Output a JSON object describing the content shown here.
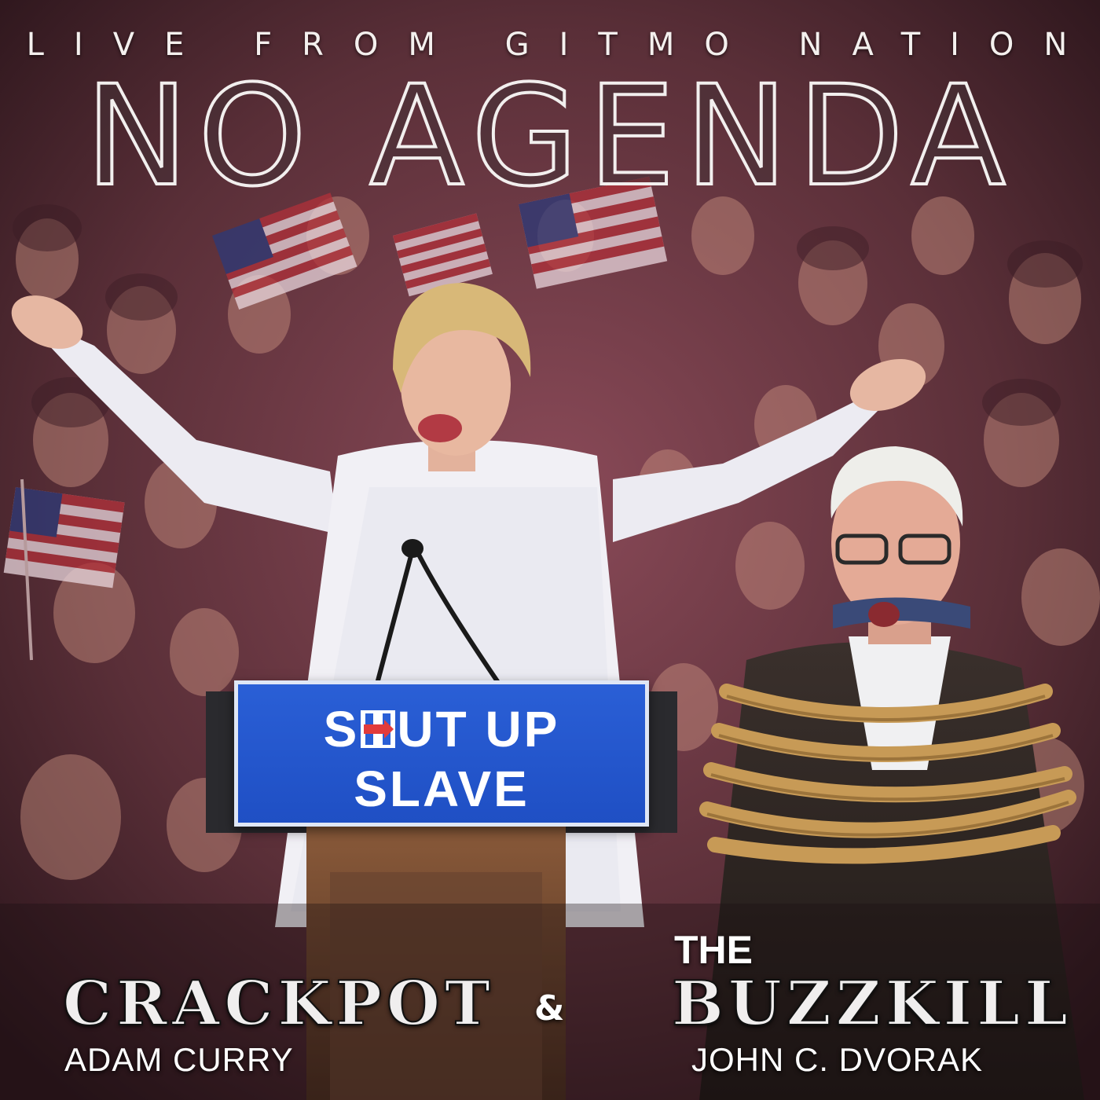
{
  "header": {
    "tagline": "LIVE FROM GITMO NATION",
    "title": "NO AGENDA"
  },
  "podium_sign": {
    "line1_part1": "S",
    "line1_part2": "UT  UP",
    "line2": "SLAVE"
  },
  "credits": {
    "left_role": "CRACKPOT",
    "left_name": "ADAM CURRY",
    "ampersand": "&",
    "right_prefix": "THE",
    "right_role": "BUZZKILL",
    "right_name": "JOHN C. DVORAK"
  },
  "colors": {
    "sign_blue": "#1f4fc4",
    "logo_red": "#e23b3b",
    "text_white": "#ffffff",
    "crowd_tone": "#5a2f38"
  }
}
